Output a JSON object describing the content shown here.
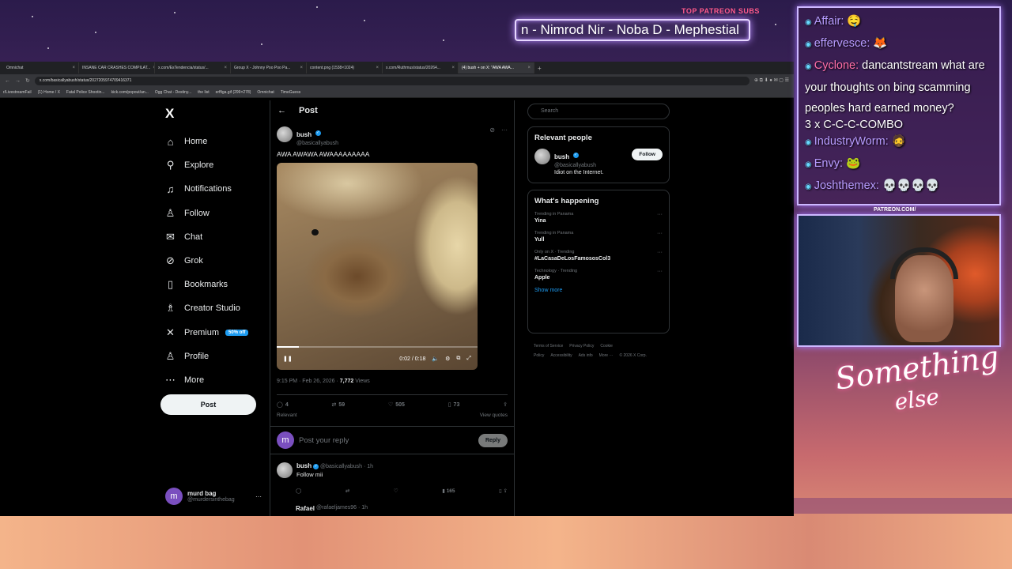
{
  "overlay": {
    "patreon_label": "TOP PATREON SUBS",
    "ticker_text": "n - Nimrod Nir - Noba D - Mephestial",
    "cam_tag": "PATREON.COM/",
    "brand_line1": "Something",
    "brand_line2": "else"
  },
  "browser": {
    "tabs": [
      {
        "label": "Omnichat",
        "active": false
      },
      {
        "label": "INSANE CAR CRASHES COMPILAT...",
        "active": false
      },
      {
        "label": "x.com/EsTendencia/status/...",
        "active": false
      },
      {
        "label": "Group X - Johnny Poo Poo Pa...",
        "active": false
      },
      {
        "label": "content.png (1538×1024)",
        "active": false
      },
      {
        "label": "x.com/Ruthmus/status/20264...",
        "active": false
      },
      {
        "label": "(4) bush + on X: \"AWA AWA...",
        "active": true
      }
    ],
    "url": "x.com/basicallyabush/status/2027205974709416371",
    "bookmarks": [
      "r/LivestreamFail",
      "(1) Home / X",
      "Fatal Police Shootin...",
      "kick.com/popout/an...",
      "Ogg Chat - Destiny...",
      "the list",
      "erffiga.gif (299×278)",
      "Omnichat",
      "TimeGuess"
    ]
  },
  "sidebar": {
    "logo": "X",
    "items": [
      {
        "label": "Home",
        "icon": "home-icon",
        "glyph": "⌂"
      },
      {
        "label": "Explore",
        "icon": "search-icon",
        "glyph": "⚲"
      },
      {
        "label": "Notifications",
        "icon": "bell-icon",
        "glyph": "♫"
      },
      {
        "label": "Follow",
        "icon": "person-add-icon",
        "glyph": "♙"
      },
      {
        "label": "Chat",
        "icon": "mail-icon",
        "glyph": "✉"
      },
      {
        "label": "Grok",
        "icon": "grok-icon",
        "glyph": "⊘"
      },
      {
        "label": "Bookmarks",
        "icon": "bookmark-icon",
        "glyph": "▯"
      },
      {
        "label": "Creator Studio",
        "icon": "creator-icon",
        "glyph": "♗"
      },
      {
        "label": "Premium",
        "icon": "premium-icon",
        "glyph": "✕"
      },
      {
        "label": "Profile",
        "icon": "profile-icon",
        "glyph": "♙"
      },
      {
        "label": "More",
        "icon": "more-icon",
        "glyph": "⋯"
      }
    ],
    "premium_badge": "50% off",
    "post_button": "Post",
    "account": {
      "initial": "m",
      "name": "murd bag",
      "handle": "@murdersinthebag",
      "menu": "···"
    }
  },
  "post": {
    "header_title": "Post",
    "back": "←",
    "author_name": "bush",
    "author_handle": "@basicallyabush",
    "text": "AWA AWAWA AWAAAAAAAAA",
    "video_time": "0:02 / 0:18",
    "video_progress": 0.11,
    "timestamp": "9:15 PM · Feb 26, 2026 · ",
    "views_count": "7,772",
    "views_label": " Views",
    "actions": {
      "replies": "4",
      "reposts": "59",
      "likes": "505",
      "bookmarks": "73"
    },
    "sort": "Relevant",
    "view_quotes": "View quotes",
    "reply_initial": "m",
    "reply_placeholder": "Post your reply",
    "reply_button": "Reply"
  },
  "replies": [
    {
      "name": "bush",
      "handle": "@basicallyabush",
      "time": "· 1h",
      "text": "Follow mii",
      "views": "165"
    },
    {
      "name": "Rafael",
      "handle": "@rafaeljames96",
      "time": "· 1h"
    }
  ],
  "right": {
    "search_placeholder": "Search",
    "relevant_title": "Relevant people",
    "person": {
      "name": "bush",
      "handle": "@basicallyabush",
      "bio": "Idiot on the Internet.",
      "follow": "Follow"
    },
    "happening_title": "What's happening",
    "trends": [
      {
        "meta": "Trending in Panama",
        "name": "Yina"
      },
      {
        "meta": "Trending in Panama",
        "name": "Yull"
      },
      {
        "meta": "Only on X · Trending",
        "name": "#LaCasaDeLosFamososCol3"
      },
      {
        "meta": "Technology · Trending",
        "name": "Apple"
      }
    ],
    "show_more": "Show more",
    "footer": [
      "Terms of Service",
      "Privacy Policy",
      "Cookie Policy",
      "Accessibility",
      "Ads info",
      "More ···",
      "© 2026 X Corp."
    ]
  },
  "chat": [
    {
      "user": "Affair:",
      "msg": " 🤤"
    },
    {
      "user": "effervesce:",
      "msg": " 🦊"
    },
    {
      "user": "Cyclone:",
      "msg": " dancantstream what are your thoughts on bing scamming peoples hard earned money?",
      "pink": true
    },
    {
      "combo": "3 x C-C-C-COMBO"
    },
    {
      "user": "IndustryWorm:",
      "msg": " 🧔"
    },
    {
      "user": "Envy:",
      "msg": " 🐸"
    },
    {
      "user": "Joshthemex:",
      "msg": " 💀💀💀💀"
    }
  ]
}
